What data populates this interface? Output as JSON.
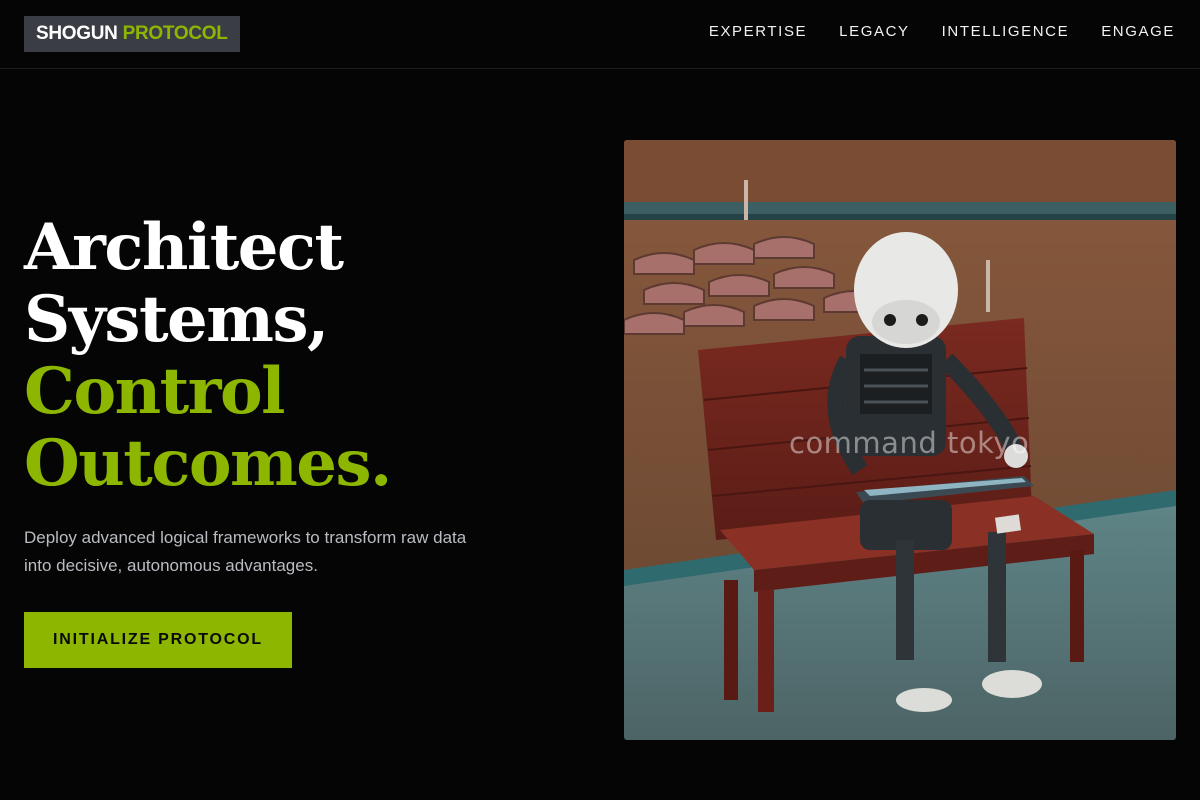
{
  "brand": {
    "word1": "SHOGUN",
    "word2": "PROTOCOL",
    "accent_color": "#8db600"
  },
  "nav": {
    "items": [
      {
        "label": "EXPERTISE"
      },
      {
        "label": "LEGACY"
      },
      {
        "label": "INTELLIGENCE"
      },
      {
        "label": "ENGAGE"
      }
    ]
  },
  "hero": {
    "headline_line1": "Architect",
    "headline_line2": "Systems,",
    "headline_line3": "Control",
    "headline_line4": "Outcomes.",
    "subtitle": "Deploy advanced logical frameworks to transform raw data into decisive, autonomous advantages.",
    "cta_label": "INITIALIZE PROTOCOL"
  },
  "image": {
    "subject": "robot sitting on bench reading tablet",
    "watermark": "command tokyo"
  },
  "colors": {
    "background": "#050505",
    "accent": "#8db600",
    "subtitle": "#b9bcc2"
  }
}
